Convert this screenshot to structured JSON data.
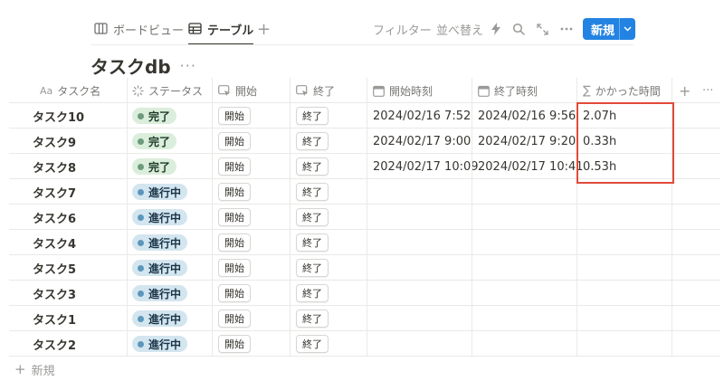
{
  "views": {
    "board_label": "ボードビュー",
    "table_label": "テーブル",
    "add_label": "+"
  },
  "toolbar": {
    "filter_label": "フィルター",
    "sort_label": "並べ替え",
    "new_label": "新規"
  },
  "page": {
    "title": "タスクdb",
    "more_label": "···"
  },
  "columns": {
    "name": "タスク名",
    "name_prefix": "Aa",
    "status": "ステータス",
    "start": "開始",
    "end": "終了",
    "start_time": "開始時刻",
    "end_time": "終了時刻",
    "duration": "かかった時間",
    "duration_prefix": "∑",
    "add_col": "+",
    "more": "···"
  },
  "rows": [
    {
      "name": "タスク10",
      "status": "完了",
      "start_btn": "開始",
      "end_btn": "終了",
      "start_time": "2024/02/16 7:52",
      "end_time": "2024/02/16 9:56",
      "duration": "2.07h"
    },
    {
      "name": "タスク9",
      "status": "完了",
      "start_btn": "開始",
      "end_btn": "終了",
      "start_time": "2024/02/17 9:00",
      "end_time": "2024/02/17 9:20",
      "duration": "0.33h"
    },
    {
      "name": "タスク8",
      "status": "完了",
      "start_btn": "開始",
      "end_btn": "終了",
      "start_time": "2024/02/17 10:09",
      "end_time": "2024/02/17 10:41",
      "duration": "0.53h"
    },
    {
      "name": "タスク7",
      "status": "進行中",
      "start_btn": "開始",
      "end_btn": "終了",
      "start_time": "",
      "end_time": "",
      "duration": ""
    },
    {
      "name": "タスク6",
      "status": "進行中",
      "start_btn": "開始",
      "end_btn": "終了",
      "start_time": "",
      "end_time": "",
      "duration": ""
    },
    {
      "name": "タスク4",
      "status": "進行中",
      "start_btn": "開始",
      "end_btn": "終了",
      "start_time": "",
      "end_time": "",
      "duration": ""
    },
    {
      "name": "タスク5",
      "status": "進行中",
      "start_btn": "開始",
      "end_btn": "終了",
      "start_time": "",
      "end_time": "",
      "duration": ""
    },
    {
      "name": "タスク3",
      "status": "進行中",
      "start_btn": "開始",
      "end_btn": "終了",
      "start_time": "",
      "end_time": "",
      "duration": ""
    },
    {
      "name": "タスク1",
      "status": "進行中",
      "start_btn": "開始",
      "end_btn": "終了",
      "start_time": "",
      "end_time": "",
      "duration": ""
    },
    {
      "name": "タスク2",
      "status": "進行中",
      "start_btn": "開始",
      "end_btn": "終了",
      "start_time": "",
      "end_time": "",
      "duration": ""
    }
  ],
  "footer": {
    "add_plus": "+",
    "add_label": "新規"
  },
  "colors": {
    "accent": "#2383e2",
    "done_bg": "#dbeddb",
    "progress_bg": "#d3e5ef",
    "highlight": "#e04b3a"
  },
  "icons": {
    "board_view": "board-view-icon",
    "table_view": "table-icon",
    "automation": "lightning-icon",
    "search": "search-icon",
    "expand": "expand-icon",
    "more": "more-icon",
    "chevron": "chevron-down-icon",
    "status_col": "status-icon",
    "button_col": "button-cursor-icon",
    "date_col": "calendar-icon"
  }
}
